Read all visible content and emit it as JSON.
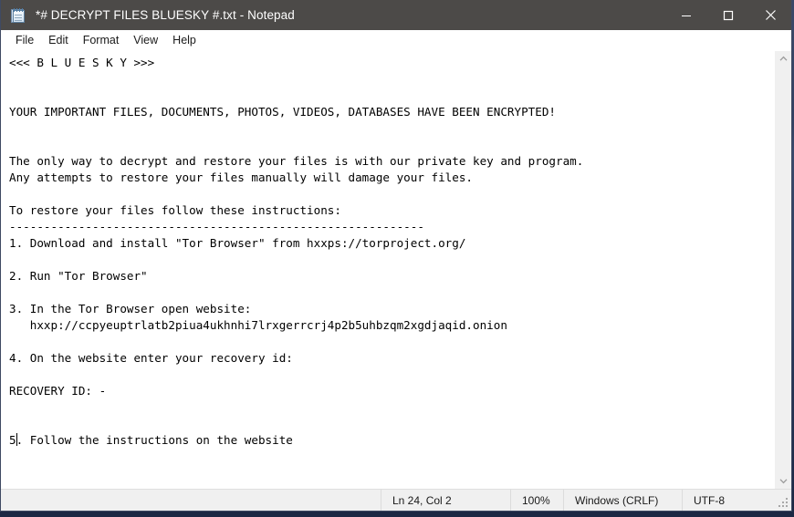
{
  "window": {
    "title": "*# DECRYPT FILES BLUESKY #.txt - Notepad",
    "icon": "notepad-icon",
    "controls": {
      "minimize": "minimize-icon",
      "maximize": "maximize-icon",
      "close": "close-icon"
    }
  },
  "menubar": {
    "items": [
      {
        "label": "File"
      },
      {
        "label": "Edit"
      },
      {
        "label": "Format"
      },
      {
        "label": "View"
      },
      {
        "label": "Help"
      }
    ]
  },
  "document": {
    "lines": [
      "<<< B L U E S K Y >>>",
      "",
      "",
      "YOUR IMPORTANT FILES, DOCUMENTS, PHOTOS, VIDEOS, DATABASES HAVE BEEN ENCRYPTED!",
      "",
      "",
      "The only way to decrypt and restore your files is with our private key and program.",
      "Any attempts to restore your files manually will damage your files.",
      "",
      "To restore your files follow these instructions:",
      "------------------------------------------------------------",
      "1. Download and install \"Tor Browser\" from hxxps://torproject.org/",
      "",
      "2. Run \"Tor Browser\"",
      "",
      "3. In the Tor Browser open website:",
      "   hxxp://ccpyeuptrlatb2piua4ukhnhi7lrxgerrcrj4p2b5uhbzqm2xgdjaqid.onion",
      "",
      "4. On the website enter your recovery id:",
      "",
      "RECOVERY ID: -",
      "",
      "",
      "5"
    ],
    "caret_tail": ". Follow the instructions on the website"
  },
  "scrollbar": {
    "up_arrow": "chevron-up-icon",
    "down_arrow": "chevron-down-icon"
  },
  "statusbar": {
    "cursor_position": "Ln 24, Col 2",
    "zoom": "100%",
    "line_ending": "Windows (CRLF)",
    "encoding": "UTF-8",
    "grip": "resize-grip-icon"
  },
  "colors": {
    "titlebar_bg": "#4c4a48",
    "titlebar_text": "#ffffff",
    "window_border": "#3f4a63",
    "editor_bg": "#ffffff",
    "editor_text": "#000000",
    "statusbar_bg": "#f0f0f0",
    "desktop_bg": "#3b4b6e"
  }
}
